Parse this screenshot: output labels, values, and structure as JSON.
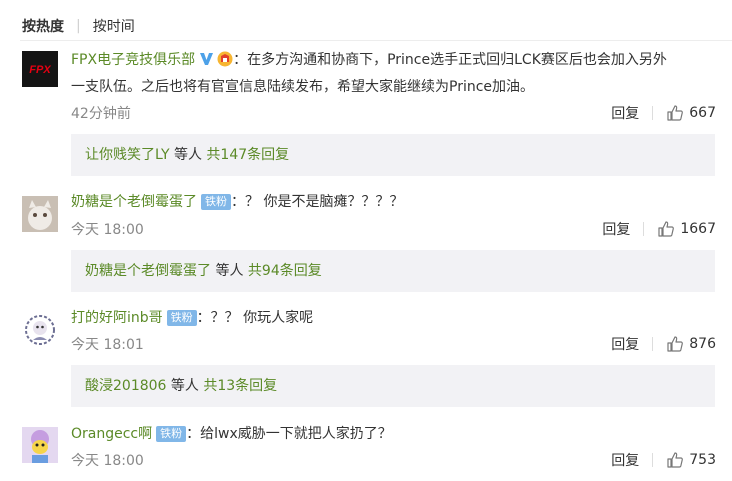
{
  "sort": {
    "hot": "按热度",
    "time": "按时间"
  },
  "comments": [
    {
      "user": "FPX电子竞技俱乐部",
      "text": "：在多方沟通和协商下，Prince选手正式回归LCK赛区后也会加入另外",
      "text2": "一支队伍。之后也将有官宣信息陆续发布，希望大家能继续为Prince加油。",
      "time": "42分钟前",
      "reply": "回复",
      "likes": "667",
      "replies": {
        "name": "让你贱笑了LY",
        "mid": " 等人 ",
        "count": "共147条回复"
      }
    },
    {
      "user": "奶糖是个老倒霉蛋了",
      "badge": "铁粉",
      "text": "：？ 你是不是脑瘫？？？？",
      "time": "今天 18:00",
      "reply": "回复",
      "likes": "1667",
      "replies": {
        "name": "奶糖是个老倒霉蛋了",
        "mid": " 等人 ",
        "count": "共94条回复"
      }
    },
    {
      "user": "打的好阿inb哥",
      "badge": "铁粉",
      "text": "：？？  你玩人家呢",
      "time": "今天 18:01",
      "reply": "回复",
      "likes": "876",
      "replies": {
        "name": "酸浸201806",
        "mid": " 等人 ",
        "count": "共13条回复"
      }
    },
    {
      "user": "Orangecc啊",
      "badge": "铁粉",
      "text": "：给lwx威胁一下就把人家扔了？",
      "time": "今天 18:00",
      "reply": "回复",
      "likes": "753"
    }
  ],
  "avatars": {
    "c0": "FPX"
  }
}
